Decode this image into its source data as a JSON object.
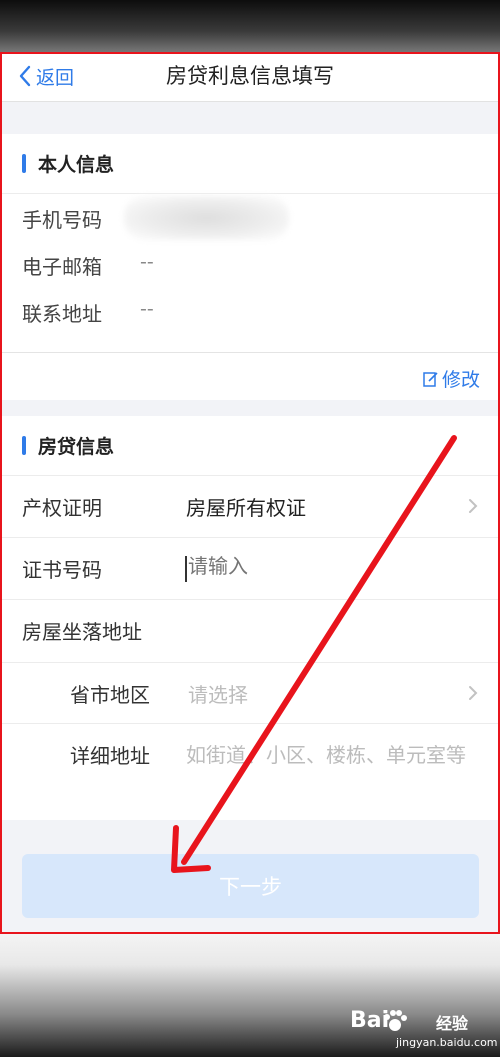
{
  "nav": {
    "back_label": "返回",
    "title": "房贷利息信息填写"
  },
  "personal": {
    "section_title": "本人信息",
    "phone_label": "手机号码",
    "email_label": "电子邮箱",
    "email_value": "--",
    "address_label": "联系地址",
    "address_value": "--",
    "edit_label": "修改"
  },
  "mortgage": {
    "section_title": "房贷信息",
    "property_cert_label": "产权证明",
    "property_cert_value": "房屋所有权证",
    "cert_number_label": "证书号码",
    "cert_number_placeholder": "请输入",
    "house_address_label": "房屋坐落地址",
    "region_label": "省市地区",
    "region_placeholder": "请选择",
    "detail_label": "详细地址",
    "detail_placeholder": "如街道、小区、楼栋、单元室等"
  },
  "next_button_label": "下一步",
  "watermark": {
    "logo": "Bai",
    "brand": "经验",
    "url": "jingyan.baidu.com"
  },
  "colors": {
    "accent": "#2f7be8",
    "annotation": "#e8141c",
    "button_disabled": "#d7e7fb"
  }
}
